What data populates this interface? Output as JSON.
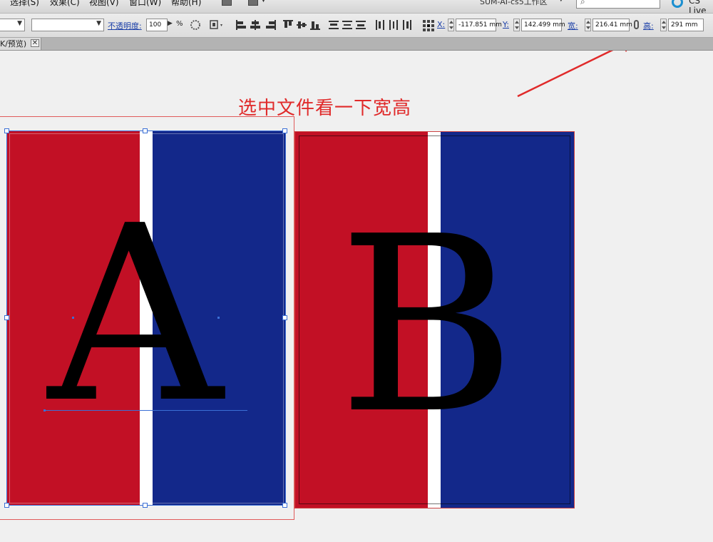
{
  "menu": {
    "items": [
      "选择(S)",
      "效果(C)",
      "视图(V)",
      "窗口(W)",
      "帮助(H)"
    ],
    "workspace": "SUM-AI-cs5工作区",
    "cs_live": "CS Live"
  },
  "control": {
    "opacity_label": "不透明度:",
    "opacity_value": "100",
    "opacity_unit": "%",
    "x_label": "X:",
    "x_value": "-117.851 mm",
    "y_label": "Y:",
    "y_value": "142.499 mm",
    "width_label": "宽:",
    "width_value": "216.41 mm",
    "height_label": "高:",
    "height_value": "291 mm"
  },
  "tab": {
    "title": "K/预览)",
    "close": "✕"
  },
  "canvas": {
    "annotation": "选中文件看一下宽高",
    "flag_a_letter": "A",
    "flag_b_letter": "B"
  },
  "colors": {
    "flag_red": "#c21025",
    "flag_white": "#ffffff",
    "flag_blue": "#13288a",
    "annotation": "#e02a2a",
    "selection": "#3b6fd6"
  }
}
